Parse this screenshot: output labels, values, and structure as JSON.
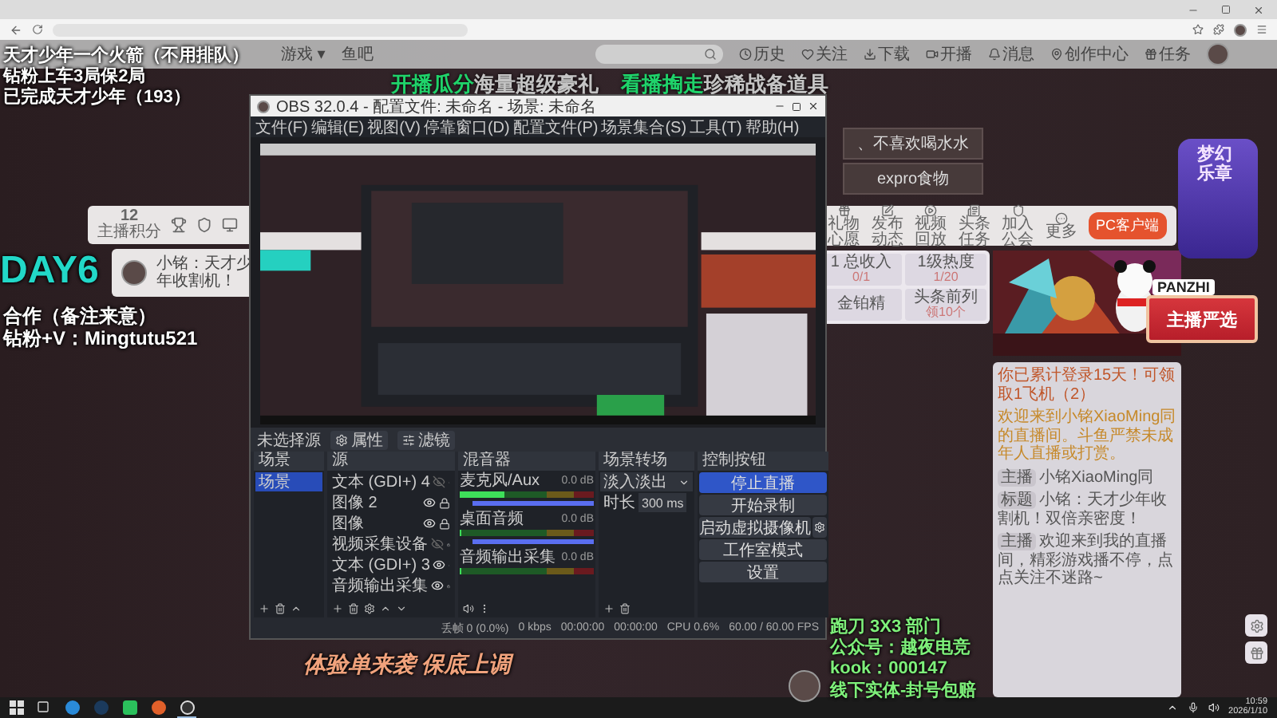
{
  "site_header": {
    "nav": [
      "游戏 ▾",
      "鱼吧"
    ],
    "icons": [
      {
        "label": "历史"
      },
      {
        "label": "关注"
      },
      {
        "label": "下载"
      },
      {
        "label": "开播"
      },
      {
        "label": "消息"
      },
      {
        "label": "创作中心"
      },
      {
        "label": "任务"
      }
    ]
  },
  "overlay": {
    "top_lines": [
      "天才少年一个火箭（不用排队）",
      "钻粉上车3局保2局",
      "已完成天才少年（193）"
    ],
    "headline": [
      {
        "text": "开播瓜分",
        "highlight": true
      },
      {
        "text": "海量超级豪礼",
        "highlight": false
      },
      {
        "text": "看播掏走",
        "highlight": true
      },
      {
        "text": "珍稀战备道具",
        "highlight": false
      }
    ],
    "day": "DAY6",
    "contact": [
      "合作（备注来意）",
      "钻粉+V：Mingtutu521"
    ],
    "banner": "体验单来袭 保底上调",
    "promo": [
      "跑刀 3X3 部门",
      "公众号：越夜电竞",
      "kook：000147",
      "线下实体-封号包赔"
    ]
  },
  "stream_buttons": [
    "、不喜欢喝水水",
    "expro食物"
  ],
  "left_toolbar": {
    "score": "12",
    "score_label": "主播积分"
  },
  "room_card": {
    "title": "小铭：天才少年收割机！"
  },
  "right_toolbar": {
    "items": [
      "礼物心愿",
      "发布动态",
      "视频回放",
      "头条任务",
      "加入公会",
      "更多"
    ],
    "pc_button": "PC客户端"
  },
  "tasks": [
    {
      "title": "1 总收入",
      "value": "0/1"
    },
    {
      "title": "1级热度",
      "value": "1/20"
    },
    {
      "title": "金铂精"
    },
    {
      "title": "头条前列",
      "value": "领10个"
    }
  ],
  "mascot": {
    "tag": "PANZHI",
    "badge": "主播严选"
  },
  "side_banner": "梦幻乐章",
  "chat": {
    "notice": "你已累计登录15天！可领取1飞机（2）",
    "warning": "欢迎来到小铭XiaoMing同的直播间。斗鱼严禁未成年人直播或打赏。",
    "info": [
      {
        "label": "主播",
        "value": "小铭XiaoMing同"
      },
      {
        "label": "标题",
        "value": "小铭：天才少年收割机！双倍亲密度！"
      }
    ],
    "messages": [
      {
        "badge": "主播",
        "text": "欢迎来到我的直播间，精彩游戏播不停，点点关注不迷路~"
      }
    ]
  },
  "obs": {
    "title": "OBS 32.0.4 - 配置文件: 未命名 - 场景: 未命名",
    "menu": [
      "文件(F)",
      "编辑(E)",
      "视图(V)",
      "停靠窗口(D)",
      "配置文件(P)",
      "场景集合(S)",
      "工具(T)",
      "帮助(H)"
    ],
    "no_source": "未选择源",
    "source_buttons": [
      "属性",
      "滤镜"
    ],
    "docks": {
      "scenes": "场景",
      "sources": "源",
      "mixer": "混音器",
      "transitions": "场景转场",
      "controls": "控制按钮"
    },
    "scenes": [
      {
        "label": "场景",
        "selected": true
      }
    ],
    "sources": [
      {
        "label": "文本 (GDI+) 4",
        "visible": false
      },
      {
        "label": "图像 2",
        "visible": true
      },
      {
        "label": "图像",
        "visible": true
      },
      {
        "label": "视频采集设备",
        "visible": false
      },
      {
        "label": "文本 (GDI+) 3",
        "visible": true
      },
      {
        "label": "音频输出采集",
        "visible": true
      }
    ],
    "mixer": [
      {
        "name": "麦克风/Aux",
        "reading": "0.0 dB",
        "meter": {
          "level": 0.32
        },
        "volume": {
          "level": 1
        }
      },
      {
        "name": "桌面音频",
        "reading": "0.0 dB",
        "meter": {
          "level": 0
        },
        "volume": {
          "level": 1
        }
      },
      {
        "name": "音频输出采集",
        "reading": "0.0 dB",
        "meter": {
          "level": 0
        }
      }
    ],
    "transition": {
      "type": "淡入淡出",
      "duration_label": "时长",
      "duration": "300 ms"
    },
    "controls": [
      {
        "label": "停止直播",
        "active": true,
        "settings": false
      },
      {
        "label": "开始录制",
        "active": false,
        "settings": false
      },
      {
        "label": "启动虚拟摄像机",
        "active": false,
        "settings": true
      },
      {
        "label": "工作室模式",
        "active": false,
        "settings": false
      },
      {
        "label": "设置",
        "active": false,
        "settings": false
      }
    ],
    "status": [
      "丢帧 0 (0.0%)",
      "0 kbps",
      "00:00:00",
      "00:00:00",
      "CPU 0.6%",
      "60.00 / 60.00 FPS"
    ]
  },
  "taskbar": {
    "time": "10:59",
    "date": "2026/1/10"
  }
}
